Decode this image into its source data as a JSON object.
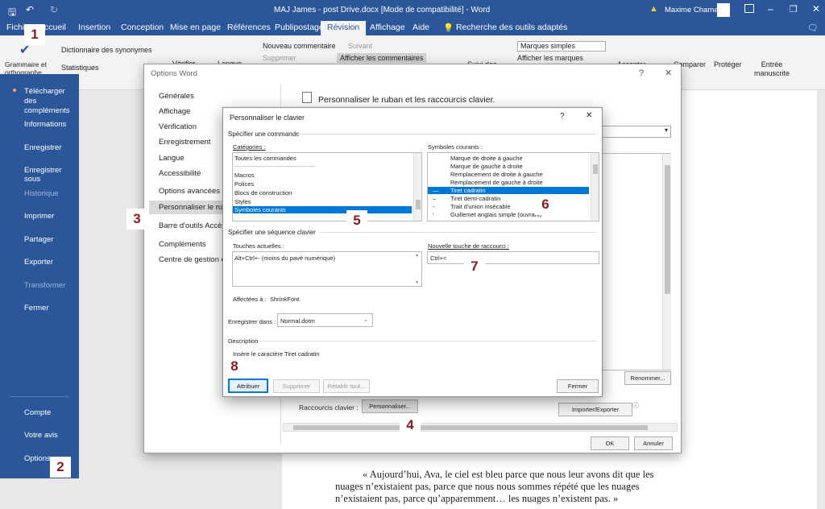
{
  "titlebar": {
    "doc_title": "MAJ James - post Drive.docx [Mode de compatibilité] - Word",
    "user": "Maxime Chamare"
  },
  "ribbon": {
    "tabs": [
      "Fichier",
      "Accueil",
      "Insertion",
      "Conception",
      "Mise en page",
      "Références",
      "Publipostage",
      "Révision",
      "Affichage",
      "Aide"
    ],
    "search": "Recherche des outils adaptés",
    "grammar": "Grammaire et orthographe",
    "dictionary": "Dictionnaire des synonymes",
    "stats": "Statistiques",
    "verify": "Vérifier",
    "language": "Langue",
    "new_comment": "Nouveau commentaire",
    "delete": "Supprimer",
    "next": "Suivant",
    "show_comments": "Afficher les commentaires",
    "markup_select": "Marques simples",
    "show_markup": "Afficher les marques",
    "track": "Suivi des",
    "accept": "Accepter",
    "compare": "Comparer",
    "protect": "Protéger",
    "ink": "Entrée manuscrite"
  },
  "backstage": {
    "items": [
      "Télécharger des compléments",
      "Informations",
      "Enregistrer",
      "Enregistrer sous",
      "Historique",
      "Imprimer",
      "Partager",
      "Exporter",
      "Transformer",
      "Fermer"
    ],
    "bottom": [
      "Compte",
      "Votre avis",
      "Options"
    ]
  },
  "options_dialog": {
    "title": "Options Word",
    "nav": [
      "Générales",
      "Affichage",
      "Vérification",
      "Enregistrement",
      "Langue",
      "Accessibilité",
      "Options avancées",
      "Personnaliser le ruban",
      "Barre d'outils Accès rapide",
      "Compléments",
      "Centre de gestion de la confidentialité"
    ],
    "header": "Personnaliser le ruban et les raccourcis clavier.",
    "shortcuts_label": "Raccourcis clavier :",
    "customize_btn": "Personnaliser...",
    "rename_btn": "Renommer...",
    "import_export": "Importer/Exporter",
    "ok": "OK",
    "cancel": "Annuler"
  },
  "keyboard_dialog": {
    "title": "Personnaliser le clavier",
    "specify_command": "Spécifier une commande",
    "categories_label": "Catégories :",
    "categories": [
      "Toutes les commandes",
      "----------------------------------------",
      "Macros",
      "Polices",
      "Blocs de construction",
      "Styles",
      "Symboles courants"
    ],
    "symbols_label": "Symboles courants :",
    "symbols": [
      "Marque de droite à gauche",
      "Marque de gauche à droite",
      "Remplacement de droite à gauche",
      "Remplacement de gauche à droite",
      "Tiret cadratin",
      "Tiret demi-cadratin",
      "Trait d'union insécable",
      "Guillemet anglais simple (ouvrant)"
    ],
    "symbol_glyphs": [
      "",
      "",
      "",
      "",
      "—",
      "–",
      "-",
      "‘"
    ],
    "specify_sequence": "Spécifier une séquence clavier",
    "current_keys_label": "Touches actuelles :",
    "current_keys": "Alt+Ctrl+- (moins du pavé numérique)",
    "new_key_label": "Nouvelle touche de raccourci :",
    "new_key": "Ctrl+<",
    "assigned_label": "Affectées à :",
    "assigned_value": "ShrinkFont",
    "save_in_label": "Enregistrer dans :",
    "save_in_value": "Normal.dotm",
    "description_label": "Description",
    "description": "Insère le caractère Tiret cadratin",
    "assign_btn": "Attribuer",
    "delete_btn": "Supprimer",
    "reset_btn": "Rétablir tout...",
    "close_btn": "Fermer"
  },
  "steps": [
    "1",
    "2",
    "3",
    "4",
    "5",
    "6",
    "7",
    "8"
  ],
  "document": {
    "lines": [
      "« Aujourd’hui, Ava, le ciel est bleu parce que nous leur avons dit que les",
      "nuages n’existaient pas, parce que nous nous sommes répété que les nuages",
      "n’existaient pas, parce qu’apparemment… les nuages n’existent pas. »"
    ]
  },
  "colors": {
    "accent": "#2b579a",
    "selection": "#0078d7",
    "step_number": "#8b1a1a"
  }
}
